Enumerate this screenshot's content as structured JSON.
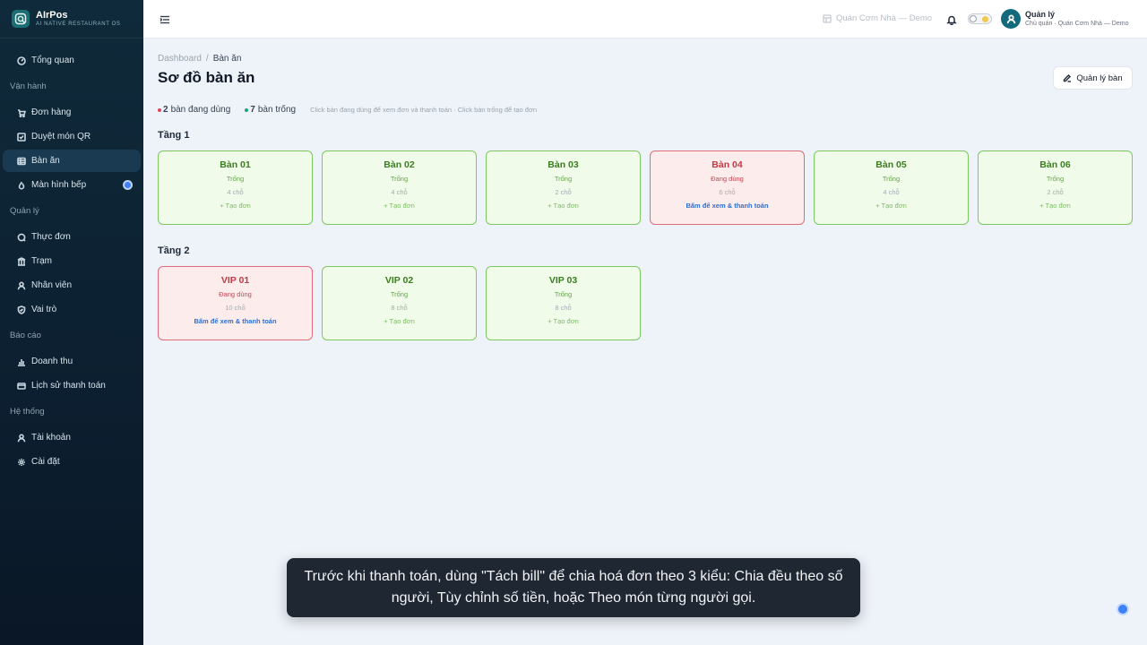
{
  "brand": {
    "name": "AIrPos",
    "tagline": "AI NATIVE RESTAURANT OS"
  },
  "sidebar": {
    "overview": "Tổng quan",
    "sections": [
      {
        "title": "Vận hành",
        "items": [
          "Đơn hàng",
          "Duyệt món QR",
          "Bàn ăn",
          "Màn hình bếp"
        ]
      },
      {
        "title": "Quản lý",
        "items": [
          "Thực đơn",
          "Trạm",
          "Nhân viên",
          "Vai trò"
        ]
      },
      {
        "title": "Báo cáo",
        "items": [
          "Doanh thu",
          "Lịch sử thanh toán"
        ]
      },
      {
        "title": "Hệ thống",
        "items": [
          "Tài khoản",
          "Cài đặt"
        ]
      }
    ],
    "active_item": "Bàn ăn"
  },
  "header": {
    "restaurant": "Quán Cơm Nhà — Demo",
    "user_name": "Quản lý",
    "user_role": "Chủ quán · Quán Cơm Nhà — Demo"
  },
  "breadcrumb": {
    "root": "Dashboard",
    "sep": "/",
    "current": "Bàn ăn"
  },
  "page_title": "Sơ đồ bàn ăn",
  "manage_button": "Quản lý bàn",
  "stats": {
    "busy_count": "2",
    "busy_label": "bàn đang dùng",
    "free_count": "7",
    "free_label": "bàn trống",
    "hint": "Click bàn đang dùng để xem đơn và thanh toán · Click bàn trống để tạo đơn",
    "busy_color": "#e0455a",
    "free_color": "#1aa37a"
  },
  "floors": [
    {
      "title": "Tầng 1",
      "tables": [
        {
          "name": "Bàn 01",
          "status": "Trống",
          "seats": "4 chỗ",
          "action": "+ Tạo đơn",
          "busy": false
        },
        {
          "name": "Bàn 02",
          "status": "Trống",
          "seats": "4 chỗ",
          "action": "+ Tạo đơn",
          "busy": false
        },
        {
          "name": "Bàn 03",
          "status": "Trống",
          "seats": "2 chỗ",
          "action": "+ Tạo đơn",
          "busy": false
        },
        {
          "name": "Bàn 04",
          "status": "Đang dùng",
          "seats": "6 chỗ",
          "action": "Bấm để xem & thanh toán",
          "busy": true
        },
        {
          "name": "Bàn 05",
          "status": "Trống",
          "seats": "4 chỗ",
          "action": "+ Tạo đơn",
          "busy": false
        },
        {
          "name": "Bàn 06",
          "status": "Trống",
          "seats": "2 chỗ",
          "action": "+ Tạo đơn",
          "busy": false
        }
      ]
    },
    {
      "title": "Tầng 2",
      "tables": [
        {
          "name": "VIP 01",
          "status": "Đang dùng",
          "seats": "10 chỗ",
          "action": "Bấm để xem & thanh toán",
          "busy": true
        },
        {
          "name": "VIP 02",
          "status": "Trống",
          "seats": "8 chỗ",
          "action": "+ Tạo đơn",
          "busy": false
        },
        {
          "name": "VIP 03",
          "status": "Trống",
          "seats": "8 chỗ",
          "action": "+ Tạo đơn",
          "busy": false
        }
      ]
    }
  ],
  "toast": "Trước khi thanh toán, dùng \"Tách bill\" để chia hoá đơn theo 3 kiểu: Chia đều theo số người, Tùy chỉnh số tiền, hoặc Theo món từng người gọi."
}
